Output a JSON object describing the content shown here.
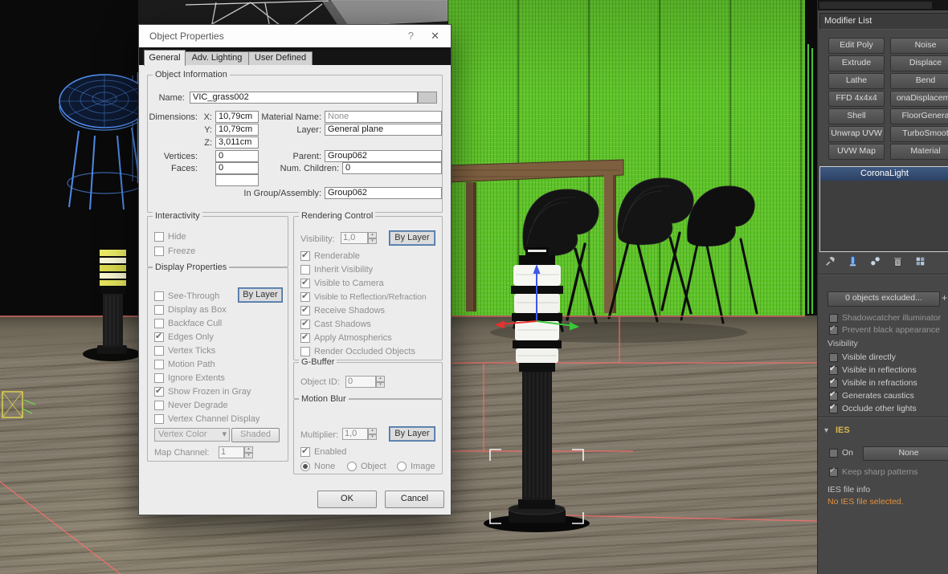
{
  "colors": {
    "panel_bg": "#474747",
    "dialog_bg": "#ececec",
    "accent_blue": "#4a6f9e",
    "wall_green": "#5fc428",
    "stack_highlight": "#2c4264",
    "ies_gold": "#d6b44e",
    "ies_warning": "#e2913e",
    "grid_red": "#ff6d6d",
    "stool_blue": "#4f8ae8"
  },
  "dialog": {
    "title": "Object Properties",
    "help_label": "?",
    "close_label": "✕",
    "tabs": [
      {
        "label": "General",
        "active": true
      },
      {
        "label": "Adv. Lighting",
        "active": false
      },
      {
        "label": "User Defined",
        "active": false
      }
    ],
    "object_information": {
      "title": "Object Information",
      "name_label": "Name:",
      "name_value": "VIC_grass002",
      "dimensions_label": "Dimensions:",
      "x_label": "X:",
      "x_value": "10,79cm",
      "y_label": "Y:",
      "y_value": "10,79cm",
      "z_label": "Z:",
      "z_value": "3,011cm",
      "material_label": "Material Name:",
      "material_value": "None",
      "layer_label": "Layer:",
      "layer_value": "General plane",
      "vertices_label": "Vertices:",
      "vertices_value": "0",
      "parent_label": "Parent:",
      "parent_value": "Group062",
      "faces_label": "Faces:",
      "faces_value": "0",
      "children_label": "Num. Children:",
      "children_value": "0",
      "extra_value": "",
      "group_label": "In Group/Assembly:",
      "group_value": "Group062"
    },
    "interactivity": {
      "title": "Interactivity",
      "items": [
        {
          "label": "Hide",
          "checked": false
        },
        {
          "label": "Freeze",
          "checked": false
        }
      ]
    },
    "display_properties": {
      "title": "Display Properties",
      "see_through_label": "See-Through",
      "by_layer_label": "By Layer",
      "items": [
        {
          "label": "Display as Box",
          "checked": false
        },
        {
          "label": "Backface Cull",
          "checked": false
        },
        {
          "label": "Edges Only",
          "checked": true
        },
        {
          "label": "Vertex Ticks",
          "checked": false
        },
        {
          "label": "Motion Path",
          "checked": false
        },
        {
          "label": "Ignore Extents",
          "checked": false
        },
        {
          "label": "Show Frozen in Gray",
          "checked": true
        },
        {
          "label": "Never Degrade",
          "checked": false
        },
        {
          "label": "Vertex Channel Display",
          "checked": false
        }
      ],
      "vertex_color_label": "Vertex Color",
      "shaded_label": "Shaded",
      "map_channel_label": "Map Channel:",
      "map_channel_value": "1"
    },
    "rendering_control": {
      "title": "Rendering Control",
      "visibility_label": "Visibility:",
      "visibility_value": "1,0",
      "by_layer_label": "By Layer",
      "items": [
        {
          "label": "Renderable",
          "checked": true
        },
        {
          "label": "Inherit Visibility",
          "checked": false
        },
        {
          "label": "Visible to Camera",
          "checked": true
        },
        {
          "label": "Visible to Reflection/Refraction",
          "checked": true
        },
        {
          "label": "Receive Shadows",
          "checked": true
        },
        {
          "label": "Cast Shadows",
          "checked": true
        },
        {
          "label": "Apply Atmospherics",
          "checked": true
        },
        {
          "label": "Render Occluded Objects",
          "checked": false
        }
      ]
    },
    "g_buffer": {
      "title": "G-Buffer",
      "object_id_label": "Object ID:",
      "object_id_value": "0"
    },
    "motion_blur": {
      "title": "Motion Blur",
      "multiplier_label": "Multiplier:",
      "multiplier_value": "1,0",
      "by_layer_label": "By Layer",
      "enabled_label": "Enabled",
      "enabled_checked": true,
      "radios": [
        {
          "label": "None",
          "selected": true
        },
        {
          "label": "Object",
          "selected": false
        },
        {
          "label": "Image",
          "selected": false
        }
      ]
    },
    "ok_label": "OK",
    "cancel_label": "Cancel"
  },
  "right_panel": {
    "modifier_list_label": "Modifier List",
    "modifier_buttons": [
      {
        "label": "Edit Poly"
      },
      {
        "label": "Noise"
      },
      {
        "label": "Extrude"
      },
      {
        "label": "Displace"
      },
      {
        "label": "Lathe"
      },
      {
        "label": "Bend"
      },
      {
        "label": "FFD 4x4x4"
      },
      {
        "label": "onaDisplaceme"
      },
      {
        "label": "Shell"
      },
      {
        "label": "FloorGenera"
      },
      {
        "label": "Unwrap UVW"
      },
      {
        "label": "TurboSmoot"
      },
      {
        "label": "UVW Map"
      },
      {
        "label": "Material"
      }
    ],
    "stack_items": [
      {
        "label": "CoronaLight",
        "selected": true
      }
    ],
    "excluded_button_label": "0 objects excluded...",
    "plus_label": "+",
    "options": [
      {
        "label": "Shadowcatcher illuminator",
        "checked": false
      },
      {
        "label": "Prevent black appearance",
        "checked": true
      }
    ],
    "visibility_title": "Visibility",
    "visibility_options": [
      {
        "label": "Visible directly",
        "checked": false
      },
      {
        "label": "Visible in reflections",
        "checked": true
      },
      {
        "label": "Visible in refractions",
        "checked": true
      },
      {
        "label": "Generates caustics",
        "checked": true
      },
      {
        "label": "Occlude other lights",
        "checked": true
      }
    ],
    "ies_arrow": "▾",
    "ies_title": "IES",
    "on_label": "On",
    "on_checked": false,
    "none_button_label": "None",
    "keep_sharp_label": "Keep sharp patterns",
    "keep_sharp_checked": true,
    "ies_file_info_label": "IES file info",
    "ies_file_value": "No IES file selected."
  }
}
